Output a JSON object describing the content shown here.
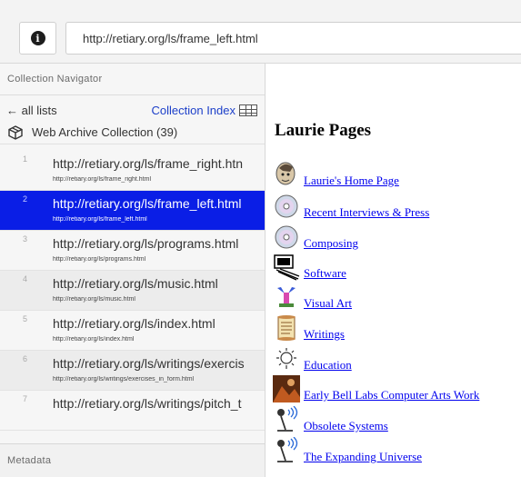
{
  "url_bar": {
    "url": "http://retiary.org/ls/frame_left.html"
  },
  "sidebar": {
    "navigator_title": "Collection Navigator",
    "back_label": "← all lists",
    "index_label": "Collection Index",
    "collection_label": "Web Archive Collection (39)",
    "metadata_title": "Metadata",
    "items": [
      {
        "num": "1",
        "title": "http://retiary.org/ls/frame_right.htn",
        "sub": "http://retiary.org/ls/frame_right.html"
      },
      {
        "num": "2",
        "title": "http://retiary.org/ls/frame_left.html",
        "sub": "http://retiary.org/ls/frame_left.html"
      },
      {
        "num": "3",
        "title": "http://retiary.org/ls/programs.html",
        "sub": "http://retiary.org/ls/programs.html"
      },
      {
        "num": "4",
        "title": "http://retiary.org/ls/music.html",
        "sub": "http://retiary.org/ls/music.html"
      },
      {
        "num": "5",
        "title": "http://retiary.org/ls/index.html",
        "sub": "http://retiary.org/ls/index.html"
      },
      {
        "num": "6",
        "title": "http://retiary.org/ls/writings/exercis",
        "sub": "http://retiary.org/ls/writings/exercises_in_form.html"
      },
      {
        "num": "7",
        "title": "http://retiary.org/ls/writings/pitch_t",
        "sub": ""
      }
    ]
  },
  "content": {
    "title": "Laurie Pages",
    "links": [
      {
        "label": "Laurie's Home Page",
        "icon": "portrait-icon"
      },
      {
        "label": "Recent Interviews & Press",
        "icon": "cd-icon"
      },
      {
        "label": "Composing",
        "icon": "cd-icon"
      },
      {
        "label": "Software",
        "icon": "computer-icon"
      },
      {
        "label": "Visual Art",
        "icon": "sculpture-icon"
      },
      {
        "label": "Writings",
        "icon": "scroll-icon"
      },
      {
        "label": "Education",
        "icon": "lightbulb-icon"
      },
      {
        "label": "Early Bell Labs Computer Arts Work",
        "icon": "photo-icon"
      },
      {
        "label": "Obsolete Systems",
        "icon": "microphone-icon"
      },
      {
        "label": "The Expanding Universe",
        "icon": "microphone-icon"
      }
    ]
  },
  "colors": {
    "active_item": "#0a1ee6",
    "link": "#0000ee",
    "index_link": "#1c3fc9"
  }
}
